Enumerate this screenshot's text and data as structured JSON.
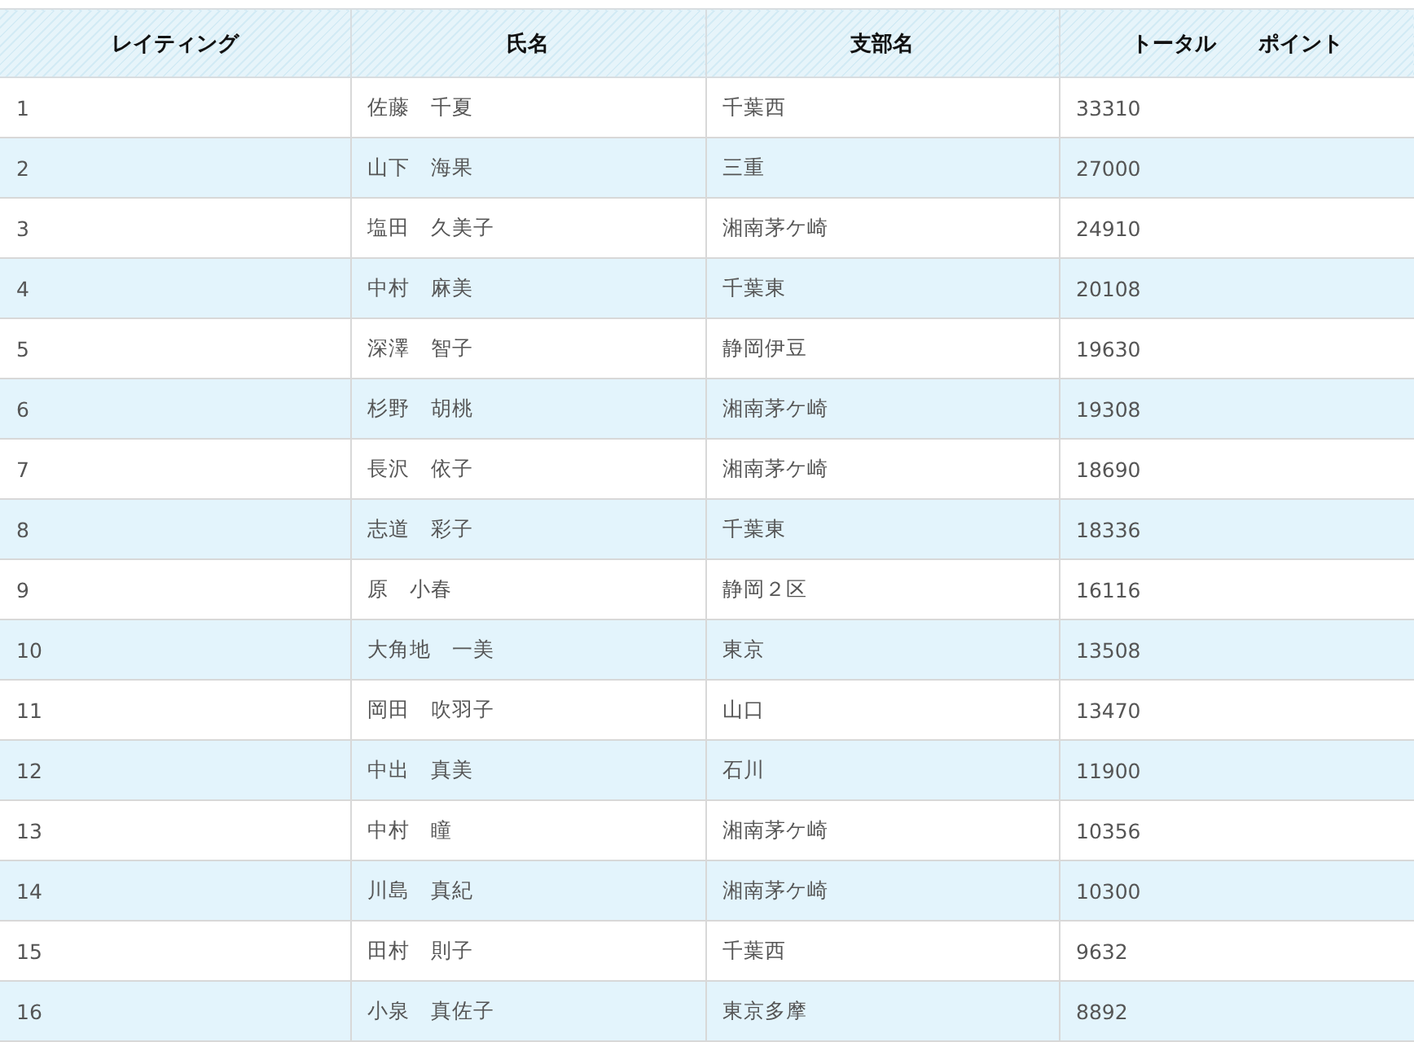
{
  "table": {
    "columns": [
      "レイティング",
      "氏名",
      "支部名",
      "トータル　　ポイント"
    ],
    "rows": [
      [
        "1",
        "佐藤　千夏",
        "千葉西",
        "33310"
      ],
      [
        "2",
        "山下　海果",
        "三重",
        "27000"
      ],
      [
        "3",
        "塩田　久美子",
        "湘南茅ケ崎",
        "24910"
      ],
      [
        "4",
        "中村　麻美",
        "千葉東",
        "20108"
      ],
      [
        "5",
        "深澤　智子",
        "静岡伊豆",
        "19630"
      ],
      [
        "6",
        "杉野　胡桃",
        "湘南茅ケ崎",
        "19308"
      ],
      [
        "7",
        "長沢　依子",
        "湘南茅ケ崎",
        "18690"
      ],
      [
        "8",
        "志道　彩子",
        "千葉東",
        "18336"
      ],
      [
        "9",
        "原　小春",
        "静岡２区",
        "16116"
      ],
      [
        "10",
        "大角地　一美",
        "東京",
        "13508"
      ],
      [
        "11",
        "岡田　吹羽子",
        "山口",
        "13470"
      ],
      [
        "12",
        "中出　真美",
        "石川",
        "11900"
      ],
      [
        "13",
        "中村　瞳",
        "湘南茅ケ崎",
        "10356"
      ],
      [
        "14",
        "川島　真紀",
        "湘南茅ケ崎",
        "10300"
      ],
      [
        "15",
        "田村　則子",
        "千葉西",
        "9632"
      ],
      [
        "16",
        "小泉　真佐子",
        "東京多摩",
        "8892"
      ]
    ]
  }
}
